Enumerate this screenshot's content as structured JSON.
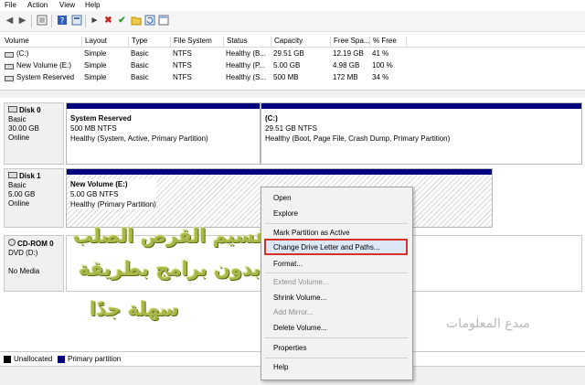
{
  "menubar": {
    "items": [
      "File",
      "Action",
      "View",
      "Help"
    ]
  },
  "toolbar": {
    "icons": [
      "back-icon",
      "forward-icon",
      "list-icon",
      "help-icon",
      "properties-icon",
      "connect-icon",
      "delete-icon",
      "check-icon",
      "open-icon",
      "refresh-icon"
    ]
  },
  "volume_list": {
    "columns": [
      "Volume",
      "Layout",
      "Type",
      "File System",
      "Status",
      "Capacity",
      "Free Spa...",
      "% Free"
    ],
    "rows": [
      {
        "volume": "(C:)",
        "layout": "Simple",
        "type": "Basic",
        "fs": "NTFS",
        "status": "Healthy (B...",
        "capacity": "29.51 GB",
        "free": "12.19 GB",
        "pct": "41 %"
      },
      {
        "volume": "New Volume (E:)",
        "layout": "Simple",
        "type": "Basic",
        "fs": "NTFS",
        "status": "Healthy (P...",
        "capacity": "5.00 GB",
        "free": "4.98 GB",
        "pct": "100 %"
      },
      {
        "volume": "System Reserved",
        "layout": "Simple",
        "type": "Basic",
        "fs": "NTFS",
        "status": "Healthy (S...",
        "capacity": "500 MB",
        "free": "172 MB",
        "pct": "34 %"
      }
    ]
  },
  "disks": [
    {
      "name": "Disk 0",
      "type": "Basic",
      "size": "30.00 GB",
      "state": "Online",
      "partitions": [
        {
          "title": "System Reserved",
          "size": "500 MB NTFS",
          "status": "Healthy (System, Active, Primary Partition)"
        },
        {
          "title": "(C:)",
          "size": "29.51 GB NTFS",
          "status": "Healthy (Boot, Page File, Crash Dump, Primary Partition)"
        }
      ]
    },
    {
      "name": "Disk 1",
      "type": "Basic",
      "size": "5.00 GB",
      "state": "Online",
      "partitions": [
        {
          "title": "New Volume  (E:)",
          "size": "5.00 GB NTFS",
          "status": "Healthy (Primary Partition)"
        }
      ]
    },
    {
      "name": "CD-ROM 0",
      "type": "DVD (D:)",
      "size": "",
      "state": "No Media",
      "partitions": []
    }
  ],
  "legend": {
    "unallocated": "Unallocated",
    "primary": "Primary partition",
    "primary_color": "#00007f"
  },
  "context_menu": {
    "items": [
      {
        "label": "Open",
        "enabled": true
      },
      {
        "label": "Explore",
        "enabled": true
      },
      {
        "label": "Mark Partition as Active",
        "enabled": true
      },
      {
        "label": "Change Drive Letter and Paths...",
        "enabled": true,
        "highlighted": true
      },
      {
        "label": "Format...",
        "enabled": true
      },
      {
        "label": "Extend Volume...",
        "enabled": false
      },
      {
        "label": "Shrink Volume...",
        "enabled": true
      },
      {
        "label": "Add Mirror...",
        "enabled": false
      },
      {
        "label": "Delete Volume...",
        "enabled": true
      },
      {
        "label": "Properties",
        "enabled": true
      },
      {
        "label": "Help",
        "enabled": true
      }
    ],
    "highlight_color": "#d8302b"
  },
  "overlay": {
    "line1": "تقسيم القرص الصلب",
    "line2": "بدون برامج بطريقة",
    "line3": "سهلة جدًا",
    "watermark": "مبدع المعلومات"
  }
}
